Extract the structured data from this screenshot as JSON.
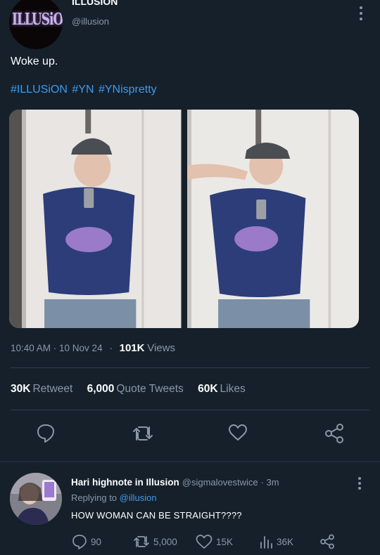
{
  "tweet": {
    "author_name": "ILLUSION",
    "author_handle": "@illusion",
    "avatar_logo_text": "ILLUSiON",
    "text": "Woke up.",
    "hashtags": [
      "#ILLUSiON",
      "#YN",
      "#YNispretty"
    ],
    "timestamp": "10:40 AM · 10 Nov 24",
    "separator": "·",
    "views_count": "101K",
    "views_label": "Views"
  },
  "stats": {
    "retweets": "30K",
    "retweets_label": "Retweet",
    "quotes": "6,000",
    "quotes_label": "Quote Tweets",
    "likes": "60K",
    "likes_label": "Likes"
  },
  "icons": {
    "reply": "reply-icon",
    "retweet": "retweet-icon",
    "like": "heart-icon",
    "share": "share-icon",
    "more": "more-vertical-icon",
    "views": "bar-chart-icon"
  },
  "reply": {
    "name": "Hari highnote in Illusion",
    "handle": "@sigmalovestwice",
    "time": "· 3m",
    "replying_prefix": "Replying to",
    "replying_to": "@illusion",
    "text": "HOW WOMAN CAN BE STRAIGHT????",
    "reply_count": "90",
    "retweet_count": "5,000",
    "like_count": "15K",
    "view_count": "36K"
  },
  "colors": {
    "background": "#15202b",
    "accent": "#3e9bea",
    "muted": "#8b98a5",
    "divider": "#2f3b47"
  }
}
